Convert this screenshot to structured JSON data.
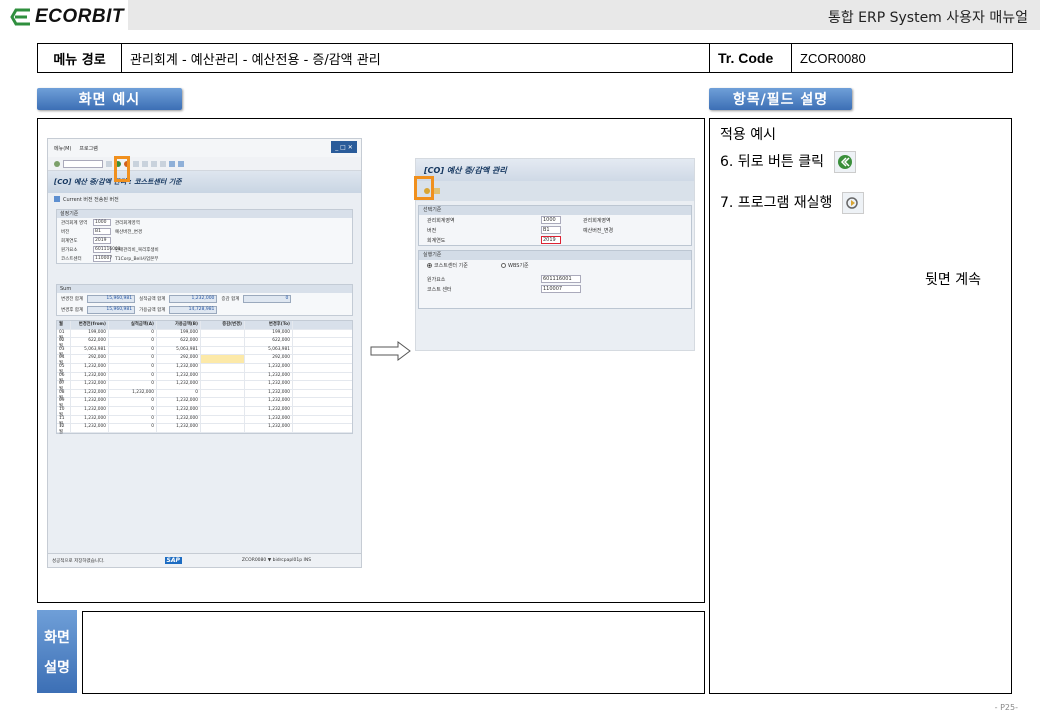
{
  "header": {
    "logo": "ECORBIT",
    "title": "통합 ERP System 사용자 매뉴얼"
  },
  "path": {
    "menu_label": "메뉴 경로",
    "menu_value": "관리회계 - 예산관리 - 예산전용 - 증/감액 관리",
    "tr_label": "Tr. Code",
    "tr_value": "ZCOR0080"
  },
  "tabs": {
    "screen_example": "화면 예시",
    "field_desc": "항목/필드 설명"
  },
  "field_panel": {
    "heading": "적용 예시",
    "step6": "6. 뒤로 버튼 클릭",
    "step7": "7. 프로그램 재실행",
    "continued": "뒷면 계속"
  },
  "desc": {
    "label_line1": "화면",
    "label_line2": "설명"
  },
  "page_number": "- P25-",
  "sap1": {
    "menu1": "메뉴(M)",
    "menu2": "프로그램",
    "title": "[CO] 예산 증/감액 관리 : 코스트센터 기준",
    "subbar": "Current 버전 전송된 버전",
    "group1_title": "설정기준",
    "fields": [
      {
        "k": "관리회계 영역",
        "v": "1000",
        "x": "관리회계영역"
      },
      {
        "k": "버전",
        "v": "B1",
        "x": "예산버전_변경"
      },
      {
        "k": "회계연도",
        "v": "2019",
        "x": ""
      },
      {
        "k": "원가요소",
        "v": "601116001",
        "x": "판매관리비_복리후생비"
      },
      {
        "k": "코스트센터",
        "v": "110007",
        "x": "T1Corp_Bell사업본부"
      }
    ],
    "sum_title": "Sum",
    "sum_rows": [
      {
        "l1": "변경전 합계",
        "v1": "15,960,981",
        "l2": "실적금액 합계",
        "v2": "1,232,000",
        "l3": "증감 합계",
        "v3": "0"
      },
      {
        "l1": "변경후 합계",
        "v1": "15,960,981",
        "l2": "가용금액 합계",
        "v2": "14,728,981",
        "l3": "",
        "v3": ""
      }
    ],
    "grid_head": [
      "월",
      "변경전(from)",
      "실적금액(A)",
      "가용금액(B)",
      "증감(변경)",
      "변경후(To)"
    ],
    "grid_rows": [
      [
        "01월",
        "199,000",
        "0",
        "199,000",
        "",
        "199,000"
      ],
      [
        "02월",
        "622,000",
        "0",
        "622,000",
        "",
        "622,000"
      ],
      [
        "03월",
        "5,063,981",
        "0",
        "5,063,981",
        "",
        "5,063,981"
      ],
      [
        "04월",
        "292,000",
        "0",
        "292,000",
        "",
        "292,000"
      ],
      [
        "05월",
        "1,232,000",
        "0",
        "1,232,000",
        "",
        "1,232,000"
      ],
      [
        "06월",
        "1,232,000",
        "0",
        "1,232,000",
        "",
        "1,232,000"
      ],
      [
        "07월",
        "1,232,000",
        "0",
        "1,232,000",
        "",
        "1,232,000"
      ],
      [
        "08월",
        "1,232,000",
        "1,232,000",
        "0",
        "",
        "1,232,000"
      ],
      [
        "09월",
        "1,232,000",
        "0",
        "1,232,000",
        "",
        "1,232,000"
      ],
      [
        "10월",
        "1,232,000",
        "0",
        "1,232,000",
        "",
        "1,232,000"
      ],
      [
        "11월",
        "1,232,000",
        "0",
        "1,232,000",
        "",
        "1,232,000"
      ],
      [
        "12월",
        "1,232,000",
        "0",
        "1,232,000",
        "",
        "1,232,000"
      ]
    ],
    "status_left": "성공적으로 저장하였습니다.",
    "status_logo": "SAP",
    "status_right": "ZCOR0080 ▼ bidrcpapl01p INS"
  },
  "sap2": {
    "title": "[CO] 예산 증/감액 관리",
    "group1_title": "선택기준",
    "fields": [
      {
        "k": "관리회계영역",
        "v": "1000",
        "x": "관리회계영역"
      },
      {
        "k": "버전",
        "v": "B1",
        "x": "예산버전_변경"
      },
      {
        "k": "회계연도",
        "v": "2019",
        "x": ""
      }
    ],
    "group2_title": "실행기준",
    "radio1": "코스트센터 기준",
    "radio2": "WBS기준",
    "fields2": [
      {
        "k": "원가요소",
        "v": "601116001"
      },
      {
        "k": "코스트 센터",
        "v": "110007"
      }
    ]
  },
  "colors": {
    "tab_blue": "#3c6fb5",
    "highlight_orange": "#f0901e",
    "logo_green": "#2f8f3e"
  }
}
